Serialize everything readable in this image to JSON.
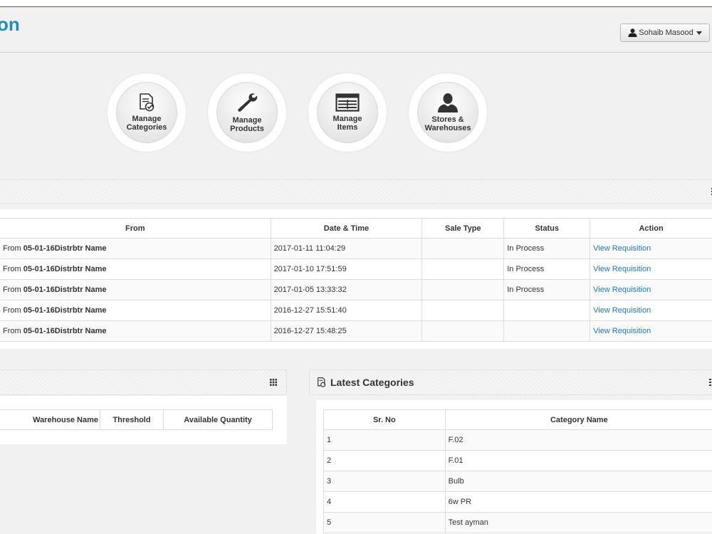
{
  "header": {
    "title": "on",
    "user_name": "Sohaib Masood"
  },
  "shortcuts": [
    {
      "label": "Manage Categories",
      "icon": "document-check-icon"
    },
    {
      "label": "Manage Products",
      "icon": "wrench-icon"
    },
    {
      "label": "Manage Items",
      "icon": "table-icon"
    },
    {
      "label": "Stores & Warehouses",
      "icon": "person-icon"
    }
  ],
  "requisitions": {
    "columns": [
      "From",
      "Date & Time",
      "Sale Type",
      "Status",
      "Action"
    ],
    "rows": [
      {
        "from_prefix": "From ",
        "from_name": "05-01-16Distrbtr Name",
        "datetime": "2017-01-11 11:04:29",
        "sale_type": "",
        "status": "In Process",
        "action": "View Requisition"
      },
      {
        "from_prefix": "From ",
        "from_name": "05-01-16Distrbtr Name",
        "datetime": "2017-01-10 17:51:59",
        "sale_type": "",
        "status": "In Process",
        "action": "View Requisition"
      },
      {
        "from_prefix": "From ",
        "from_name": "05-01-16Distrbtr Name",
        "datetime": "2017-01-05 13:33:32",
        "sale_type": "",
        "status": "In Process",
        "action": "View Requisition"
      },
      {
        "from_prefix": "From ",
        "from_name": "05-01-16Distrbtr Name",
        "datetime": "2016-12-27 15:51:40",
        "sale_type": "",
        "status": "",
        "action": "View Requisition"
      },
      {
        "from_prefix": "From ",
        "from_name": "05-01-16Distrbtr Name",
        "datetime": "2016-12-27 15:48:25",
        "sale_type": "",
        "status": "",
        "action": "View Requisition"
      }
    ]
  },
  "stock": {
    "columns": [
      "Warehouse Name",
      "Threshold",
      "Available Quantity"
    ]
  },
  "categories": {
    "title": "Latest Categories",
    "columns": [
      "Sr. No",
      "Category Name"
    ],
    "rows": [
      {
        "sr": "1",
        "name": "F.02"
      },
      {
        "sr": "2",
        "name": "F.01"
      },
      {
        "sr": "3",
        "name": "Bulb"
      },
      {
        "sr": "4",
        "name": "6w PR"
      },
      {
        "sr": "5",
        "name": "Test ayman"
      }
    ]
  },
  "colors": {
    "accent": "#1e8bc3",
    "link": "#1e77c3"
  }
}
